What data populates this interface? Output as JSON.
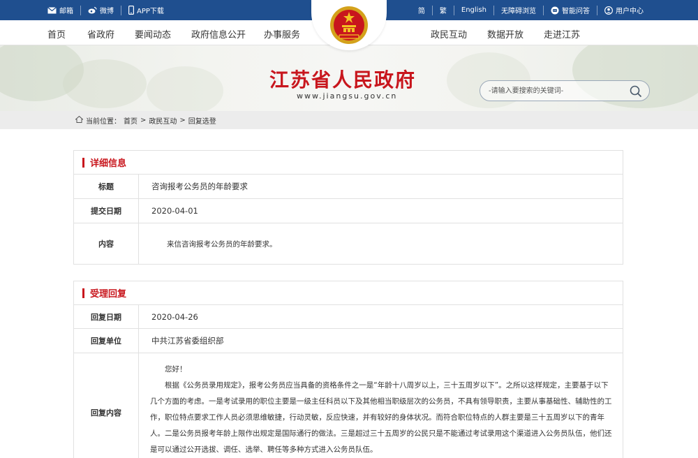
{
  "topbar": {
    "email": "邮箱",
    "weibo": "微博",
    "app": "APP下载",
    "simplified": "简",
    "traditional": "繁",
    "english": "English",
    "accessible": "无障碍浏览",
    "qa": "智能问答",
    "user_center": "用户中心"
  },
  "nav": {
    "home": "首页",
    "province_gov": "省政府",
    "news": "要闻动态",
    "info_public": "政府信息公开",
    "services": "办事服务",
    "interaction": "政民互动",
    "open_data": "数据开放",
    "jiangsu": "走进江苏"
  },
  "banner": {
    "site_title": "江苏省人民政府",
    "site_url": "www.jiangsu.gov.cn",
    "search_placeholder": "-请输入要搜索的关键词-"
  },
  "breadcrumb": {
    "label": "当前位置：",
    "home": "首页",
    "sep": ">",
    "interaction": "政民互动",
    "current": "回复选登"
  },
  "detail": {
    "heading": "详细信息",
    "title_label": "标题",
    "title_value": "咨询报考公务员的年龄要求",
    "date_label": "提交日期",
    "date_value": "2020-04-01",
    "content_label": "内容",
    "content_value": "来信咨询报考公务员的年龄要求。"
  },
  "reply": {
    "heading": "受理回复",
    "date_label": "回复日期",
    "date_value": "2020-04-26",
    "unit_label": "回复单位",
    "unit_value": "中共江苏省委组织部",
    "content_label": "回复内容",
    "greeting": "您好！",
    "paragraph": "根据《公务员录用规定》，报考公务员应当具备的资格条件之一是“年龄十八周岁以上，三十五周岁以下”。之所以这样规定，主要基于以下几个方面的考虑。一是考试录用的职位主要是一级主任科员以下及其他相当职级层次的公务员，不具有领导职责，主要从事基础性、辅助性的工作，职位特点要求工作人员必须思维敏捷，行动灵敏，反应快速，并有较好的身体状况。而符合职位特点的人群主要是三十五周岁以下的青年人。二是公务员报考年龄上限作出规定是国际通行的做法。三是超过三十五周岁的公民只是不能通过考试录用这个渠道进入公务员队伍，他们还是可以通过公开选拔、调任、选举、聘任等多种方式进入公务员队伍。"
  },
  "colors": {
    "topbar_bg": "#1f4f8f",
    "accent_red": "#c8161d"
  }
}
